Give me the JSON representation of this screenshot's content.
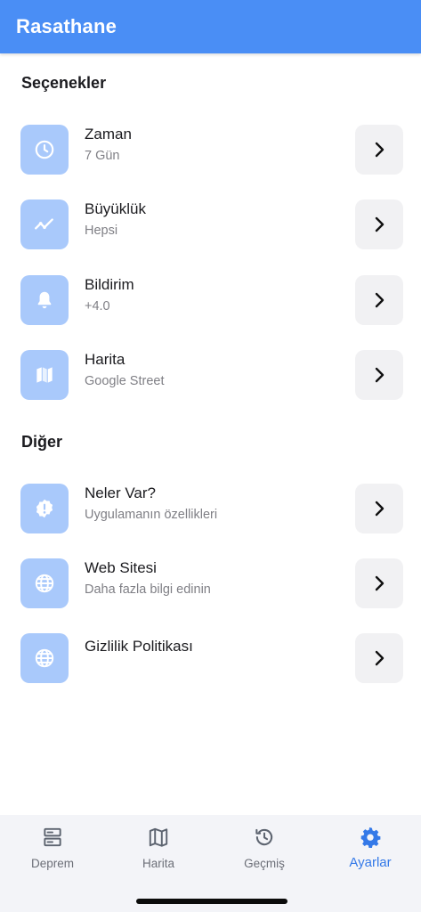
{
  "header": {
    "title": "Rasathane"
  },
  "colors": {
    "header": "#4a8ef5",
    "icon_bg": "#a9c9fb",
    "active_tab": "#3479e8"
  },
  "sections": {
    "options": {
      "title": "Seçenekler",
      "items": [
        {
          "title": "Zaman",
          "subtitle": "7 Gün",
          "icon": "clock-icon"
        },
        {
          "title": "Büyüklük",
          "subtitle": "Hepsi",
          "icon": "trend-line-icon"
        },
        {
          "title": "Bildirim",
          "subtitle": "+4.0",
          "icon": "bell-icon"
        },
        {
          "title": "Harita",
          "subtitle": "Google Street",
          "icon": "map-icon"
        }
      ]
    },
    "other": {
      "title": "Diğer",
      "items": [
        {
          "title": "Neler Var?",
          "subtitle": "Uygulamanın özellikleri",
          "icon": "alert-badge-icon"
        },
        {
          "title": "Web Sitesi",
          "subtitle": "Daha fazla bilgi edinin",
          "icon": "globe-icon"
        },
        {
          "title": "Gizlilik Politikası",
          "subtitle": "",
          "icon": "globe-icon"
        }
      ]
    }
  },
  "tabs": [
    {
      "label": "Deprem",
      "icon": "server-icon",
      "active": false
    },
    {
      "label": "Harita",
      "icon": "map-icon",
      "active": false
    },
    {
      "label": "Geçmiş",
      "icon": "history-icon",
      "active": false
    },
    {
      "label": "Ayarlar",
      "icon": "gear-icon",
      "active": true
    }
  ]
}
